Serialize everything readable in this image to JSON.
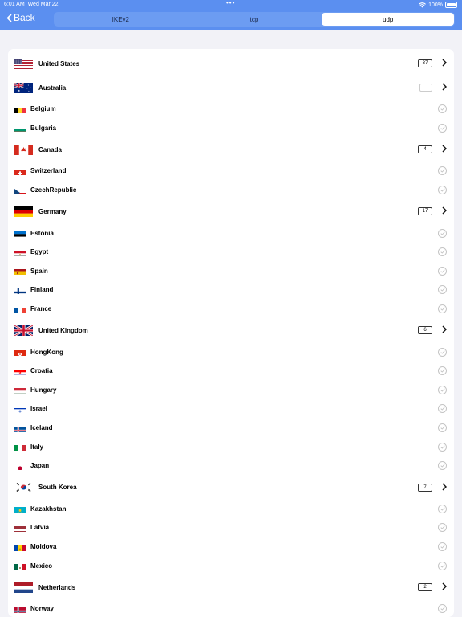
{
  "status_bar": {
    "time": "6:01 AM",
    "date": "Wed Mar 22",
    "battery": "100%"
  },
  "nav": {
    "back_label": "Back"
  },
  "protocols": [
    {
      "label": "IKEv2",
      "selected": false
    },
    {
      "label": "tcp",
      "selected": false
    },
    {
      "label": "udp",
      "selected": true
    }
  ],
  "countries": [
    {
      "name": "United States",
      "type": "group",
      "count": "37",
      "flag": "us"
    },
    {
      "name": "Australia",
      "type": "group",
      "count": "",
      "flag": "au"
    },
    {
      "name": "Belgium",
      "type": "server",
      "flag": "be"
    },
    {
      "name": "Bulgaria",
      "type": "server",
      "flag": "bg"
    },
    {
      "name": "Canada",
      "type": "group",
      "count": "4",
      "flag": "ca"
    },
    {
      "name": "Switzerland",
      "type": "server",
      "flag": "ch"
    },
    {
      "name": "CzechRepublic",
      "type": "server",
      "flag": "cz"
    },
    {
      "name": "Germany",
      "type": "group",
      "count": "17",
      "flag": "de"
    },
    {
      "name": "Estonia",
      "type": "server",
      "flag": "ee"
    },
    {
      "name": "Egypt",
      "type": "server",
      "flag": "eg"
    },
    {
      "name": "Spain",
      "type": "server",
      "flag": "es"
    },
    {
      "name": "Finland",
      "type": "server",
      "flag": "fi"
    },
    {
      "name": "France",
      "type": "server",
      "flag": "fr"
    },
    {
      "name": "United Kingdom",
      "type": "group",
      "count": "6",
      "flag": "gb"
    },
    {
      "name": "HongKong",
      "type": "server",
      "flag": "hk"
    },
    {
      "name": "Croatia",
      "type": "server",
      "flag": "hr"
    },
    {
      "name": "Hungary",
      "type": "server",
      "flag": "hu"
    },
    {
      "name": "Israel",
      "type": "server",
      "flag": "il"
    },
    {
      "name": "Iceland",
      "type": "server",
      "flag": "is"
    },
    {
      "name": "Italy",
      "type": "server",
      "flag": "it"
    },
    {
      "name": "Japan",
      "type": "server",
      "flag": "jp"
    },
    {
      "name": "South Korea",
      "type": "group",
      "count": "7",
      "flag": "kr"
    },
    {
      "name": "Kazakhstan",
      "type": "server",
      "flag": "kz"
    },
    {
      "name": "Latvia",
      "type": "server",
      "flag": "lv"
    },
    {
      "name": "Moldova",
      "type": "server",
      "flag": "md"
    },
    {
      "name": "Mexico",
      "type": "server",
      "flag": "mx"
    },
    {
      "name": "Netherlands",
      "type": "group",
      "count": "2",
      "flag": "nl"
    },
    {
      "name": "Norway",
      "type": "server",
      "flag": "no"
    }
  ]
}
